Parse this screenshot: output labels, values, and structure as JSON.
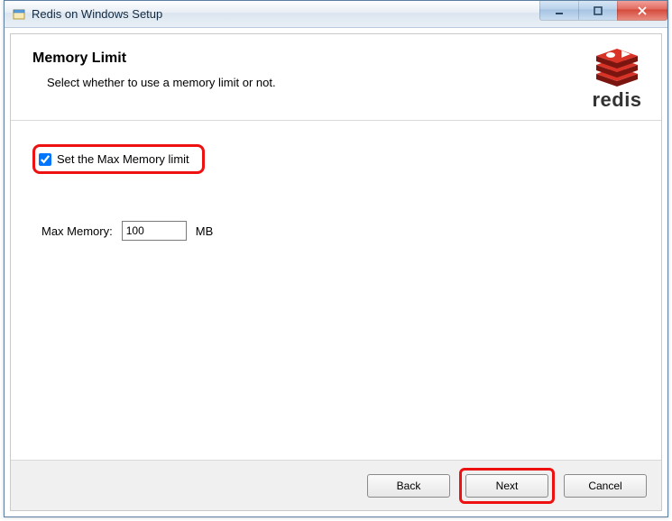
{
  "window": {
    "title": "Redis on Windows Setup"
  },
  "header": {
    "title": "Memory Limit",
    "subtitle": "Select whether to use a memory limit or not.",
    "logo_text": "redis"
  },
  "body": {
    "checkbox_label": "Set the Max Memory limit",
    "checkbox_checked": true,
    "max_memory_label": "Max Memory:",
    "max_memory_value": "100",
    "max_memory_unit": "MB"
  },
  "footer": {
    "back": "Back",
    "next": "Next",
    "cancel": "Cancel"
  }
}
